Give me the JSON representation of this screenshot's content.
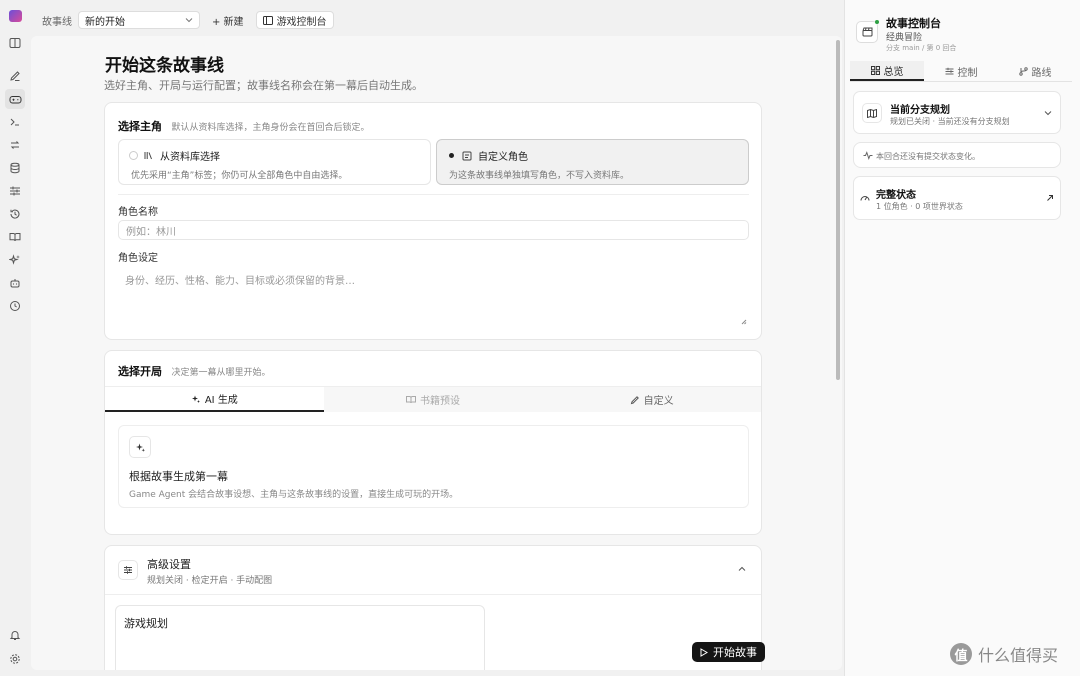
{
  "topbar": {
    "storyline_label": "故事线",
    "storyline_value": "新的开始",
    "new_label": "+ 新建",
    "console_label": "游戏控制台"
  },
  "page": {
    "title": "开始这条故事线",
    "subtitle": "选好主角、开局与运行配置；故事线名称会在第一幕后自动生成。"
  },
  "protagonist": {
    "title": "选择主角",
    "hint": "默认从资料库选择，主角身份会在首回合后锁定。",
    "options": [
      {
        "label": "从资料库选择",
        "desc": "优先采用“主角”标签；你仍可从全部角色中自由选择。",
        "selected": false
      },
      {
        "label": "自定义角色",
        "desc": "为这条故事线单独填写角色，不写入资料库。",
        "selected": true
      }
    ],
    "name_label": "角色名称",
    "name_placeholder": "例如：林川",
    "setting_label": "角色设定",
    "setting_placeholder": "身份、经历、性格、能力、目标或必须保留的背景…"
  },
  "opening": {
    "title": "选择开局",
    "hint": "决定第一幕从哪里开始。",
    "tabs": [
      "AI 生成",
      "书籍预设",
      "自定义"
    ],
    "gen_title": "根据故事生成第一幕",
    "gen_desc": "Game Agent 会结合故事设想、主角与这条故事线的设置，直接生成可玩的开场。"
  },
  "advanced": {
    "title": "高级设置",
    "desc": "规划关闭 · 检定开启 · 手动配图",
    "sub_title": "游戏规划"
  },
  "start_button": "开始故事",
  "right": {
    "title": "故事控制台",
    "subtitle": "经典冒险",
    "meta": "分支 main / 第 0 回合",
    "tabs": [
      "总览",
      "控制",
      "路线"
    ],
    "plan_title": "当前分支规划",
    "plan_desc": "规划已关闭 · 当前还没有分支规划",
    "notice": "本回合还没有提交状态变化。",
    "state_title": "完整状态",
    "state_desc": "1 位角色 · 0 项世界状态"
  },
  "watermark": {
    "symbol": "值",
    "text": "什么值得买"
  },
  "colors": {
    "accent": "#151515",
    "online": "#2ea043"
  }
}
